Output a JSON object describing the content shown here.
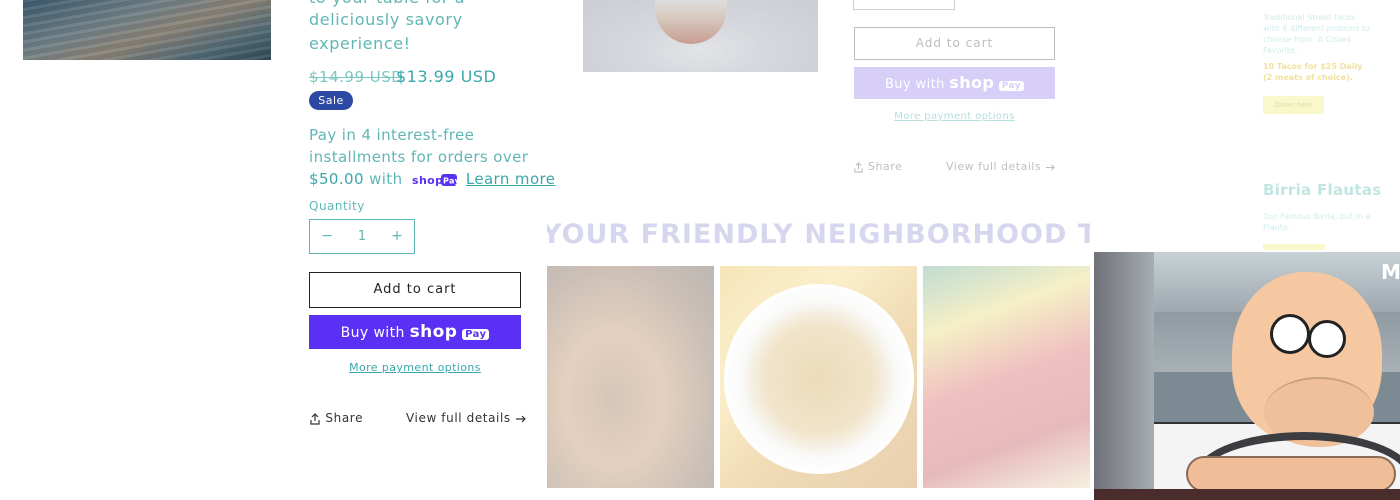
{
  "product": {
    "description_lines": [
      "to your table for a",
      "deliciously savory",
      "experience!"
    ],
    "price_regular": "$14.99 USD",
    "price_sale": "$13.99 USD",
    "sale_badge": "Sale",
    "installments": {
      "line1": "Pay in 4 interest-free",
      "line2": "installments for orders over",
      "amount": "$50.00",
      "with": "with",
      "learn_more": "Learn more"
    },
    "quantity_label": "Quantity",
    "quantity_value": "1",
    "quantity_minus": "−",
    "quantity_plus": "+",
    "add_to_cart": "Add to cart",
    "buy_with": "Buy with",
    "shop_brand": "shop",
    "pay_brand": "Pay",
    "more_payment_options": "More payment options",
    "share": "Share",
    "view_full_details": "View full details"
  },
  "faded_product": {
    "add_to_cart": "Add to cart",
    "buy_with": "Buy with",
    "shop_brand": "shop",
    "pay_brand": "Pay",
    "more_payment_options": "More payment options",
    "share": "Share",
    "view_full_details": "View full details"
  },
  "marquee": {
    "text": "YOUR FRIENDLY NEIGHBORHOOD TACO STAND"
  },
  "side_panel": {
    "blurb": "Traditional Street tacos with 6 different proteins to choose from. A Crowd Favorite.",
    "deal": "10 Tacos for $25 Daily (2 meats of choice).",
    "order_button": "Order here",
    "title": "Birria Flautas",
    "title_blurb": "Our Famous Birria, but in a Flauta."
  },
  "video": {
    "badge": "M"
  },
  "colors": {
    "accent_teal": "#5fb7b5",
    "sale_badge": "#2c4aa3",
    "shop_pay_purple": "#5a31f4"
  }
}
